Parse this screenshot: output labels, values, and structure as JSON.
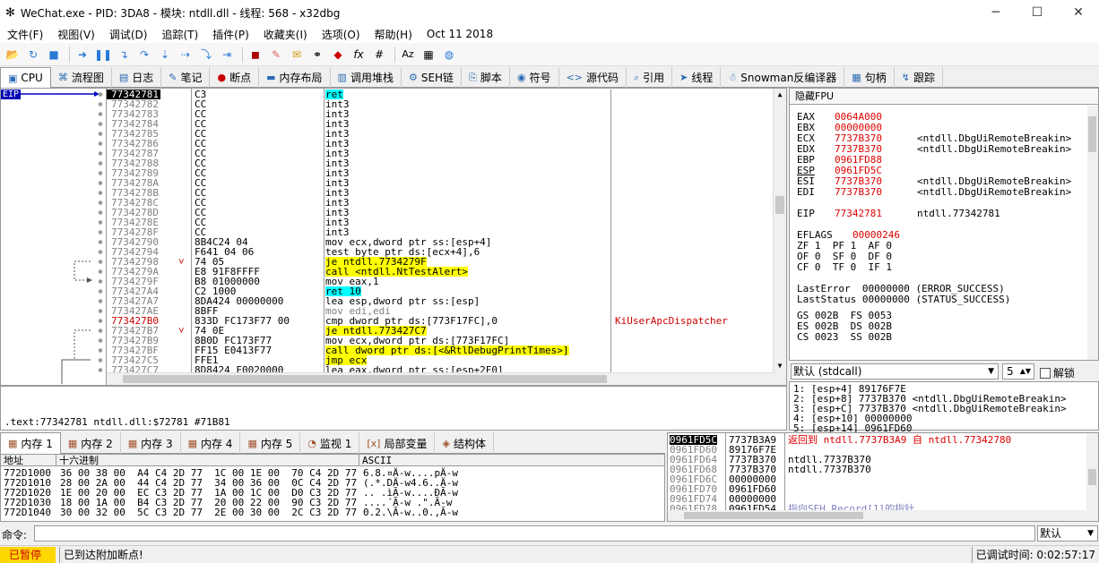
{
  "title": "WeChat.exe - PID: 3DA8 - 模块: ntdll.dll - 线程: 568 - x32dbg",
  "menu": [
    "文件(F)",
    "视图(V)",
    "调试(D)",
    "追踪(T)",
    "插件(P)",
    "收藏夹(I)",
    "选项(O)",
    "帮助(H)",
    "Oct 11 2018"
  ],
  "tabs": [
    {
      "label": "CPU",
      "icon": "cpu-icon"
    },
    {
      "label": "流程图",
      "icon": "graph-icon"
    },
    {
      "label": "日志",
      "icon": "log-icon"
    },
    {
      "label": "笔记",
      "icon": "notes-icon"
    },
    {
      "label": "断点",
      "icon": "breakpoint-icon"
    },
    {
      "label": "内存布局",
      "icon": "memory-map-icon"
    },
    {
      "label": "调用堆栈",
      "icon": "call-stack-icon"
    },
    {
      "label": "SEH链",
      "icon": "seh-icon"
    },
    {
      "label": "脚本",
      "icon": "script-icon"
    },
    {
      "label": "符号",
      "icon": "symbols-icon"
    },
    {
      "label": "源代码",
      "icon": "source-icon"
    },
    {
      "label": "引用",
      "icon": "references-icon"
    },
    {
      "label": "线程",
      "icon": "threads-icon"
    },
    {
      "label": "Snowman反编译器",
      "icon": "snowman-icon"
    },
    {
      "label": "句柄",
      "icon": "handles-icon"
    },
    {
      "label": "跟踪",
      "icon": "trace-icon"
    }
  ],
  "eip_label": "EIP",
  "disasm": [
    {
      "addr": "77342781",
      "bytes": "C3",
      "instr": "ret",
      "cmt": ""
    },
    {
      "addr": "77342782",
      "bytes": "CC",
      "instr": "int3",
      "cmt": ""
    },
    {
      "addr": "77342783",
      "bytes": "CC",
      "instr": "int3",
      "cmt": ""
    },
    {
      "addr": "77342784",
      "bytes": "CC",
      "instr": "int3",
      "cmt": ""
    },
    {
      "addr": "77342785",
      "bytes": "CC",
      "instr": "int3",
      "cmt": ""
    },
    {
      "addr": "77342786",
      "bytes": "CC",
      "instr": "int3",
      "cmt": ""
    },
    {
      "addr": "77342787",
      "bytes": "CC",
      "instr": "int3",
      "cmt": ""
    },
    {
      "addr": "77342788",
      "bytes": "CC",
      "instr": "int3",
      "cmt": ""
    },
    {
      "addr": "77342789",
      "bytes": "CC",
      "instr": "int3",
      "cmt": ""
    },
    {
      "addr": "7734278A",
      "bytes": "CC",
      "instr": "int3",
      "cmt": ""
    },
    {
      "addr": "7734278B",
      "bytes": "CC",
      "instr": "int3",
      "cmt": ""
    },
    {
      "addr": "7734278C",
      "bytes": "CC",
      "instr": "int3",
      "cmt": ""
    },
    {
      "addr": "7734278D",
      "bytes": "CC",
      "instr": "int3",
      "cmt": ""
    },
    {
      "addr": "7734278E",
      "bytes": "CC",
      "instr": "int3",
      "cmt": ""
    },
    {
      "addr": "7734278F",
      "bytes": "CC",
      "instr": "int3",
      "cmt": ""
    },
    {
      "addr": "77342790",
      "bytes": "8B4C24 04",
      "instr": "mov ecx,dword ptr ss:[esp+4]",
      "cmt": ""
    },
    {
      "addr": "77342794",
      "bytes": "F641 04 06",
      "instr": "test byte ptr ds:[ecx+4],6",
      "cmt": ""
    },
    {
      "addr": "77342798",
      "bytes": "74 05",
      "instr": "je ntdll.7734279F",
      "cmt": ""
    },
    {
      "addr": "7734279A",
      "bytes": "E8 91F8FFFF",
      "instr": "call <ntdll.NtTestAlert>",
      "cmt": ""
    },
    {
      "addr": "7734279F",
      "bytes": "B8 01000000",
      "instr": "mov eax,1",
      "cmt": ""
    },
    {
      "addr": "773427A4",
      "bytes": "C2 1000",
      "instr": "ret 10",
      "cmt": ""
    },
    {
      "addr": "773427A7",
      "bytes": "8DA424 00000000",
      "instr": "lea esp,dword ptr ss:[esp]",
      "cmt": ""
    },
    {
      "addr": "773427AE",
      "bytes": "8BFF",
      "instr": "mov edi,edi",
      "cmt": ""
    },
    {
      "addr": "773427B0",
      "bytes": "833D FC173F77 00",
      "instr": "cmp dword ptr ds:[773F17FC],0",
      "cmt": "KiUserApcDispatcher"
    },
    {
      "addr": "773427B7",
      "bytes": "74 0E",
      "instr": "je ntdll.773427C7",
      "cmt": ""
    },
    {
      "addr": "773427B9",
      "bytes": "8B0D FC173F77",
      "instr": "mov ecx,dword ptr ds:[773F17FC]",
      "cmt": ""
    },
    {
      "addr": "773427BF",
      "bytes": "FF15 E0413F77",
      "instr": "call dword ptr ds:[<&RtlDebugPrintTimes>]",
      "cmt": ""
    },
    {
      "addr": "773427C5",
      "bytes": "FFE1",
      "instr": "jmp ecx",
      "cmt": ""
    },
    {
      "addr": "773427C7",
      "bytes": "8D8424 F0020000",
      "instr": "lea eax,dword ptr ss:[esp+2F0]",
      "cmt": ""
    }
  ],
  "info_line": ".text:77342781 ntdll.dll:$72781 #71B81",
  "regs_header": "隐藏FPU",
  "regs": [
    {
      "n": "EAX",
      "v": "0064A000",
      "c": ""
    },
    {
      "n": "EBX",
      "v": "00000000",
      "c": ""
    },
    {
      "n": "ECX",
      "v": "7737B370",
      "c": "<ntdll.DbgUiRemoteBreakin>"
    },
    {
      "n": "EDX",
      "v": "7737B370",
      "c": "<ntdll.DbgUiRemoteBreakin>"
    },
    {
      "n": "EBP",
      "v": "0961FD88",
      "c": ""
    },
    {
      "n": "ESP",
      "v": "0961FD5C",
      "c": ""
    },
    {
      "n": "ESI",
      "v": "7737B370",
      "c": "<ntdll.DbgUiRemoteBreakin>"
    },
    {
      "n": "EDI",
      "v": "7737B370",
      "c": "<ntdll.DbgUiRemoteBreakin>"
    }
  ],
  "eip_reg": {
    "n": "EIP",
    "v": "77342781",
    "c": "ntdll.77342781"
  },
  "eflags": {
    "n": "EFLAGS",
    "v": "00000246"
  },
  "flags": [
    "ZF 1  PF 1  AF 0",
    "OF 0  SF 0  DF 0",
    "CF 0  TF 0  IF 1"
  ],
  "lasterror": "LastError  00000000 (ERROR_SUCCESS)",
  "laststatus": "LastStatus 00000000 (STATUS_SUCCESS)",
  "segs": [
    "GS 002B  FS 0053",
    "ES 002B  DS 002B",
    "CS 0023  SS 002B"
  ],
  "callconv": "默认 (stdcall)",
  "argcount": "5",
  "unlock": "解锁",
  "stackargs": [
    "1: [esp+4] 89176F7E",
    "2: [esp+8] 7737B370 <ntdll.DbgUiRemoteBreakin>",
    "3: [esp+C] 7737B370 <ntdll.DbgUiRemoteBreakin>",
    "4: [esp+10] 00000000",
    "5: [esp+14] 0961FD60"
  ],
  "memtabs": [
    {
      "label": "内存 1",
      "icon": "memory-icon"
    },
    {
      "label": "内存 2",
      "icon": "memory-icon"
    },
    {
      "label": "内存 3",
      "icon": "memory-icon"
    },
    {
      "label": "内存 4",
      "icon": "memory-icon"
    },
    {
      "label": "内存 5",
      "icon": "memory-icon"
    },
    {
      "label": "监视 1",
      "icon": "watch-icon"
    },
    {
      "label": "局部变量",
      "icon": "locals-icon"
    },
    {
      "label": "结构体",
      "icon": "struct-icon"
    }
  ],
  "dump_headers": {
    "addr": "地址",
    "hex": "十六进制",
    "ascii": "ASCII"
  },
  "dump": [
    {
      "addr": "772D1000",
      "hex": "36 00 38 00  A4 C4 2D 77  1C 00 1E 00  70 C4 2D 77",
      "ascii": "6.8.¤Ä-w....pÄ-w"
    },
    {
      "addr": "772D1010",
      "hex": "28 00 2A 00  44 C4 2D 77  34 00 36 00  0C C4 2D 77",
      "ascii": "(.*.DÄ-w4.6..Ä-w"
    },
    {
      "addr": "772D1020",
      "hex": "1E 00 20 00  EC C3 2D 77  1A 00 1C 00  D0 C3 2D 77",
      "ascii": ".. .ìÃ-w....ÐÃ-w"
    },
    {
      "addr": "772D1030",
      "hex": "18 00 1A 00  B4 C3 2D 77  20 00 22 00  90 C3 2D 77",
      "ascii": "....´Ã-w .\".Ã-w"
    },
    {
      "addr": "772D1040",
      "hex": "30 00 32 00  5C C3 2D 77  2E 00 30 00  2C C3 2D 77",
      "ascii": "0.2.\\Ã-w..0.,Ã-w"
    }
  ],
  "stack": [
    {
      "a": "0961FD5C",
      "v": "7737B3A9",
      "c": "返回到 ntdll.7737B3A9 自 ntdll.77342780"
    },
    {
      "a": "0961FD60",
      "v": "89176F7E",
      "c": ""
    },
    {
      "a": "0961FD64",
      "v": "7737B370",
      "c": "ntdll.7737B370"
    },
    {
      "a": "0961FD68",
      "v": "7737B370",
      "c": "ntdll.7737B370"
    },
    {
      "a": "0961FD6C",
      "v": "00000000",
      "c": ""
    },
    {
      "a": "0961FD70",
      "v": "0961FD60",
      "c": ""
    },
    {
      "a": "0961FD74",
      "v": "00000000",
      "c": ""
    },
    {
      "a": "0961FD78",
      "v": "0961FD54",
      "c": "指向SEH_Record[1]的指针"
    }
  ],
  "cmd_label": "命令:",
  "cmd_mode": "默认",
  "status": {
    "paused": "已暂停",
    "message": "已到达附加断点!",
    "time": "已调试时间:  0:02:57:17"
  }
}
